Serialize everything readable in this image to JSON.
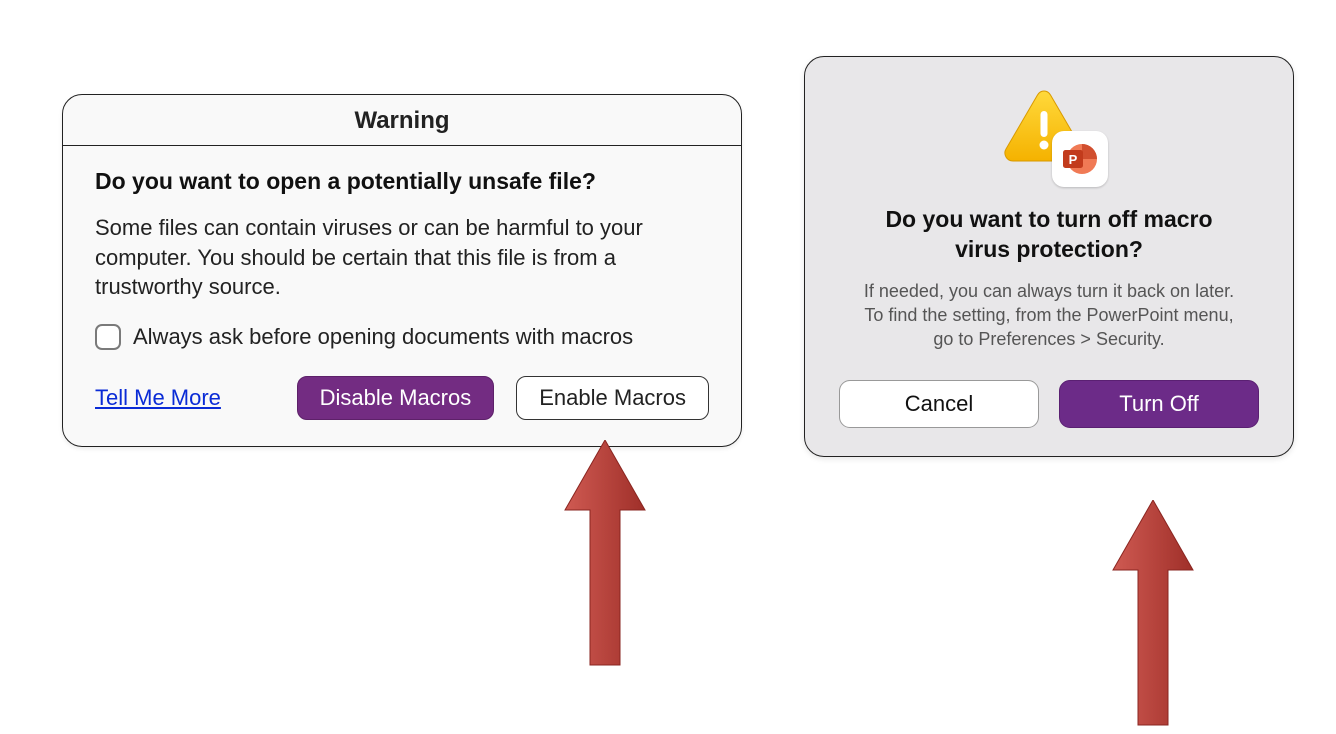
{
  "left_dialog": {
    "title": "Warning",
    "heading": "Do you want to open a potentially unsafe file?",
    "message": "Some files can contain viruses or can be harmful to your computer. You should be certain that this file is from a trustworthy source.",
    "checkbox_label": "Always ask before opening documents with macros",
    "tell_me_more": "Tell Me More",
    "disable_button": "Disable Macros",
    "enable_button": "Enable Macros"
  },
  "right_dialog": {
    "heading": "Do you want to turn off macro virus protection?",
    "message": "If needed, you can always turn it back on later. To find the setting, from the PowerPoint menu, go to Preferences > Security.",
    "cancel_button": "Cancel",
    "turnoff_button": "Turn Off",
    "app_badge_letter": "P"
  },
  "colors": {
    "accent_purple": "#732c82",
    "link_blue": "#0a2bd6",
    "arrow_red": "#b63a33"
  }
}
